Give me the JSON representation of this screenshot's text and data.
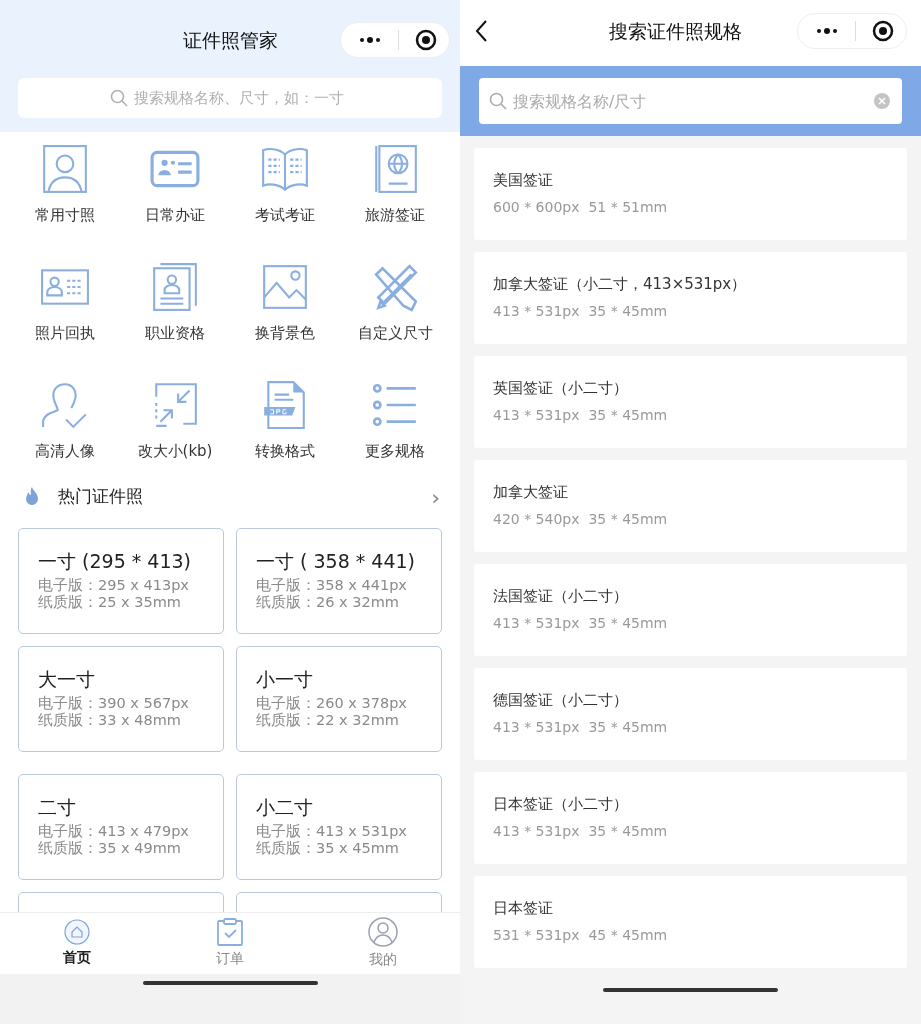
{
  "home": {
    "title": "证件照管家",
    "search": {
      "placeholder": "搜索规格名称、尺寸，如：一寸"
    },
    "categories": [
      {
        "label": "常用寸照"
      },
      {
        "label": "日常办证"
      },
      {
        "label": "考试考证"
      },
      {
        "label": "旅游签证"
      },
      {
        "label": "照片回执"
      },
      {
        "label": "职业资格"
      },
      {
        "label": "换背景色"
      },
      {
        "label": "自定义尺寸"
      },
      {
        "label": "高清人像"
      },
      {
        "label": "改大小(kb)"
      },
      {
        "label": "转换格式"
      },
      {
        "label": "更多规格"
      }
    ],
    "hot_section": {
      "title": "热门证件照",
      "chevron": "›"
    },
    "hot_cards": [
      {
        "title": "一寸 (295 * 413)",
        "detail": "电子版：295 x 413px 纸质版：25 x 35mm"
      },
      {
        "title": "一寸 ( 358 * 441)",
        "detail": "电子版：358 x 441px 纸质版：26 x 32mm"
      },
      {
        "title": "大一寸",
        "detail": "电子版：390 x 567px 纸质版：33 x 48mm"
      },
      {
        "title": "小一寸",
        "detail": "电子版：260 x 378px 纸质版：22 x 32mm"
      },
      {
        "title": "二寸",
        "detail": "电子版：413 x 479px 纸质版：35 x 49mm"
      },
      {
        "title": "小二寸",
        "detail": "电子版：413 x 531px 纸质版：35 x 45mm"
      }
    ],
    "tabs": [
      {
        "label": "首页",
        "selected": true
      },
      {
        "label": "订单",
        "selected": false
      },
      {
        "label": "我的",
        "selected": false
      }
    ]
  },
  "search_page": {
    "title": "搜索证件照规格",
    "search": {
      "placeholder": "搜索规格名称/尺寸"
    },
    "results": [
      {
        "name": "美国签证",
        "spec": "600 * 600px  51 * 51mm"
      },
      {
        "name": "加拿大签证（小二寸，413×531px）",
        "spec": "413 * 531px  35 * 45mm"
      },
      {
        "name": "英国签证（小二寸）",
        "spec": "413 * 531px  35 * 45mm"
      },
      {
        "name": "加拿大签证",
        "spec": "420 * 540px  35 * 45mm"
      },
      {
        "name": "法国签证（小二寸）",
        "spec": "413 * 531px  35 * 45mm"
      },
      {
        "name": "德国签证（小二寸）",
        "spec": "413 * 531px  35 * 45mm"
      },
      {
        "name": "日本签证（小二寸）",
        "spec": "413 * 531px  35 * 45mm"
      },
      {
        "name": "日本签证",
        "spec": "531 * 531px  45 * 45mm"
      }
    ]
  }
}
